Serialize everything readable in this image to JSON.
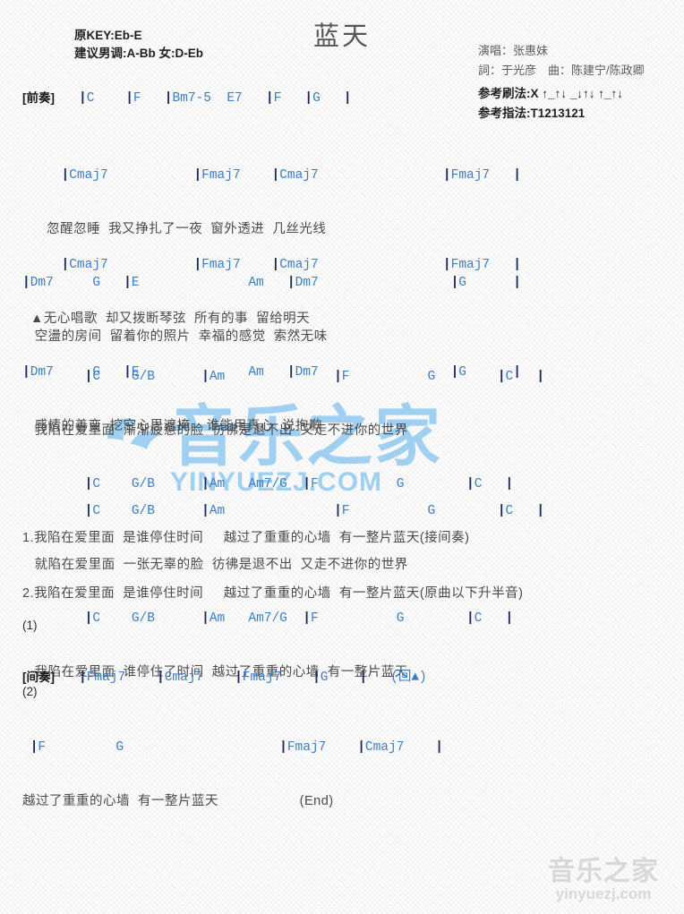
{
  "document": {
    "title": "蓝天",
    "key_info": {
      "original_key": "原KEY:Eb-E",
      "suggested_key": "建议男调:A-Bb 女:D-Eb"
    },
    "credits": {
      "singer": "演唱：张惠妹",
      "writers": "詞：于光彦　曲：陈建宁/陈政卿"
    },
    "patterns": {
      "strumming": "参考刷法:X ↑_↑↓ _↓↑↓ ↑_↑↓",
      "fingering": "参考指法:T1213121"
    }
  },
  "sections": {
    "prelude": {
      "label": "[前奏]",
      "chords": "|C    |F   |Bm7-5  E7   |F   |G   |"
    },
    "verse1": {
      "line1_chords": "     |Cmaj7           |Fmaj7    |Cmaj7                |Fmaj7   |",
      "line1_lyric": "      忽醒忽睡  我又挣扎了一夜  窗外透进  几丝光线",
      "line2_chords": "|Dm7     G   |E              Am   |Dm7                 |G      |",
      "line2_lyric": "   空盪的房间  留着你的照片  幸福的感觉  索然无味"
    },
    "verse2": {
      "line1_chords": "     |Cmaj7           |Fmaj7    |Cmaj7                |Fmaj7   |",
      "line1_lyric": "  ▲无心唱歌  却又拨断琴弦  所有的事  留给明天",
      "line2_chords": "|Dm7     G   |E              Am   |Dm7                 |G      |",
      "line2_lyric": "   感情的善变  挖空心思遮掩    谁能用真心  说抱歉"
    },
    "chorus1": {
      "line1_chords": "        |C    G/B      |Am              |F          G        |C   |",
      "line1_lyric": "   我陷在爱里面  渐渐疲惫的脸  彷彿是退不出  又走不进你的世界",
      "line2_chords": "        |C    G/B      |Am   Am7/G  |F          G        |C   |",
      "line2_lyric_1": "1.我陷在爱里面  是谁停住时间     越过了重重的心墙  有一整片蓝天(接间奏)",
      "line2_lyric_2": "2.我陷在爱里面  是谁停住时间     越过了重重的心墙  有一整片蓝天(原曲以下升半音)"
    },
    "chorus2": {
      "line1_chords": "        |C    G/B      |Am              |F          G        |C   |",
      "line1_lyric": "   就陷在爱里面  一张无辜的脸  彷彿是退不出  又走不进你的世界",
      "line2_chords": "        |C    G/B      |Am   Am7/G  |F          G        |C   |",
      "line2_lyric": "   我陷在爱里面  谁停住了时间  越过了重重的心墙  有一整片蓝天"
    },
    "interlude": {
      "number": "(1)",
      "label": "[间奏]",
      "chords": "|Fmaj7    |Cmaj7    |Fmaj7    |G    |   (回▲)"
    },
    "ending": {
      "number": "(2)",
      "chords": " |F         G                    |Fmaj7    |Cmaj7    |",
      "lyric": "越过了重重的心墙  有一整片蓝天                    (End)"
    }
  },
  "watermarks": {
    "center_cn": "音乐之家",
    "center_en": "YINYUEZJ.COM",
    "bottom_cn": "音乐之家",
    "bottom_en": "yinyuezj.com"
  }
}
